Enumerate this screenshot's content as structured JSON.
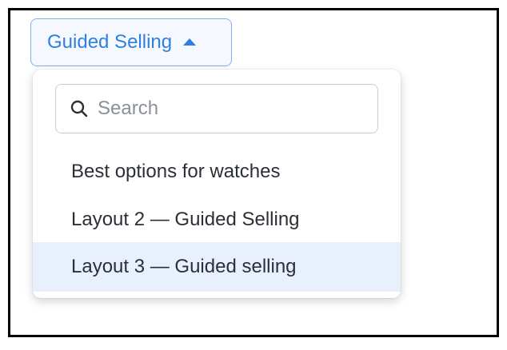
{
  "dropdown": {
    "trigger_label": "Guided Selling",
    "caret_icon": "caret-up-icon",
    "accent_color": "#2f7fe0"
  },
  "search": {
    "placeholder": "Search",
    "value": "",
    "icon": "search-icon"
  },
  "options": [
    {
      "label": "Best options for watches",
      "selected": false
    },
    {
      "label": "Layout 2 — Guided Selling",
      "selected": false
    },
    {
      "label": "Layout 3 — Guided selling",
      "selected": true
    }
  ],
  "colors": {
    "selected_background": "#e8f0fd",
    "trigger_border": "#7fb0ee"
  }
}
